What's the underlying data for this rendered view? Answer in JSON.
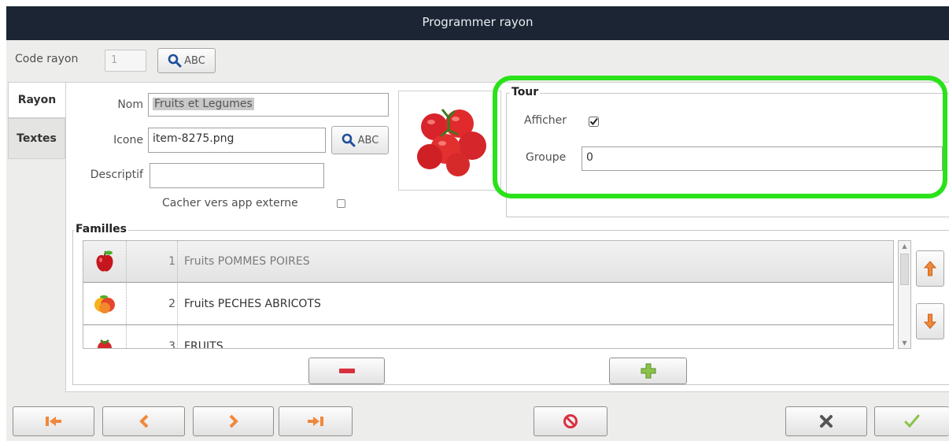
{
  "window": {
    "title": "Programmer rayon"
  },
  "code_rayon": {
    "label": "Code rayon",
    "value": "1",
    "search_label": "ABC"
  },
  "tabs": [
    {
      "label": "Rayon",
      "active": true
    },
    {
      "label": "Textes",
      "active": false
    }
  ],
  "form": {
    "nom_label": "Nom",
    "nom_value": "Fruits et Legumes",
    "icone_label": "Icone",
    "icone_value": "item-8275.png",
    "icone_search_label": "ABC",
    "descriptif_label": "Descriptif",
    "descriptif_value": "",
    "cacher_label": "Cacher vers app externe",
    "cacher_checked": false,
    "preview_icon": "tomatoes-image"
  },
  "tour": {
    "title": "Tour",
    "afficher_label": "Afficher",
    "afficher_checked": true,
    "groupe_label": "Groupe",
    "groupe_value": "0",
    "highlight_color": "#2ae21a"
  },
  "familles": {
    "title": "Familles",
    "rows": [
      {
        "num": "1",
        "name": "Fruits POMMES POIRES",
        "icon": "apple-icon",
        "selected": true
      },
      {
        "num": "2",
        "name": "Fruits PECHES ABRICOTS",
        "icon": "peach-icon",
        "selected": false
      },
      {
        "num": "3",
        "name": "FRUITS",
        "icon": "strawberry-icon",
        "selected": false
      }
    ]
  },
  "icons": {
    "remove": "minus-icon",
    "add": "plus-icon",
    "move_up": "arrow-up-icon",
    "move_down": "arrow-down-icon",
    "first": "first-record-icon",
    "previous": "chevron-left-icon",
    "next": "chevron-right-icon",
    "last": "last-record-icon",
    "delete": "prohibit-icon",
    "cancel": "x-icon",
    "validate": "checkmark-icon"
  },
  "colors": {
    "titlebar": "#1b2533",
    "accent_orange": "#f0883a",
    "accent_red": "#d9303f",
    "accent_green": "#8bc34a"
  }
}
